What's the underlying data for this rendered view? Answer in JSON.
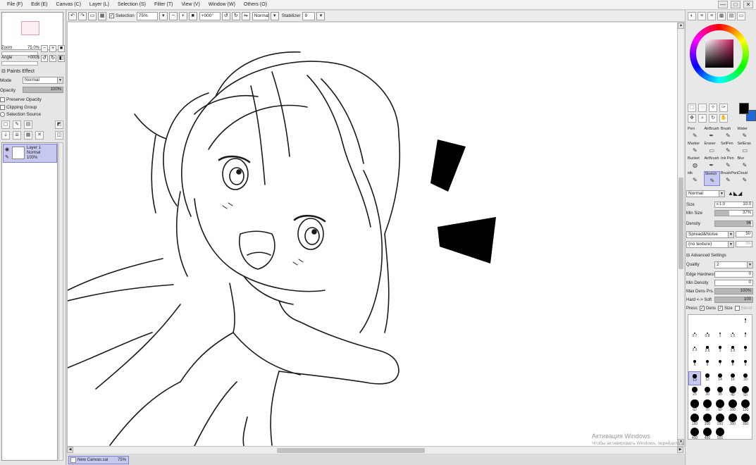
{
  "menu": [
    "File (F)",
    "Edit (E)",
    "Canvas (C)",
    "Layer (L)",
    "Selection (S)",
    "Filter (T)",
    "View (V)",
    "Window (W)",
    "Others (O)"
  ],
  "window_buttons": [
    "—",
    "□",
    "✕"
  ],
  "navigator": {
    "zoom_label": "Zoom",
    "zoom_value": "75.0%",
    "angle_label": "Angle",
    "angle_value": "+000$"
  },
  "paints_effect": {
    "title": "Paints Effect",
    "mode_label": "Mode",
    "mode_value": "Normal",
    "opacity_label": "Opacity",
    "opacity_value": "100%",
    "opacity_fraction": 1.0,
    "checkboxes": [
      "Preserve Opacity",
      "Clipping Group",
      "Selection Source"
    ]
  },
  "layer": {
    "name": "Layer 1",
    "mode": "Normal",
    "opacity": "100%"
  },
  "toolbar": {
    "selection_label": "Selection",
    "zoom_value": "75%",
    "rotation_value": "+000°",
    "mode_value": "Normal",
    "stabilizer_label": "Stabilizer",
    "stabilizer_value": "9"
  },
  "document": {
    "tab_name": "New Canvas.sai",
    "tab_zoom": "75%"
  },
  "watermark": {
    "line1": "Активация Windows",
    "line2": "Чтобы активировать Windows, перейдите в раздел \"Параметры\"."
  },
  "tools": [
    {
      "label": "Pen",
      "icon": "✎"
    },
    {
      "label": "AirBrush",
      "icon": "✒"
    },
    {
      "label": "Brush",
      "icon": "✎"
    },
    {
      "label": "Water",
      "icon": "✎"
    },
    {
      "label": "Marker",
      "icon": "✎"
    },
    {
      "label": "Eraser",
      "icon": "▭"
    },
    {
      "label": "SelPen",
      "icon": "✎"
    },
    {
      "label": "SelEras",
      "icon": "▭"
    },
    {
      "label": "Bucket",
      "icon": "◍"
    },
    {
      "label": "AirBrush",
      "icon": "✒"
    },
    {
      "label": "Ink Pen",
      "icon": "✎"
    },
    {
      "label": "Blur",
      "icon": "✎"
    },
    {
      "label": "idk",
      "icon": "✎"
    },
    {
      "label": "Sketch",
      "icon": "✎"
    },
    {
      "label": "BrushPen",
      "icon": "✎"
    },
    {
      "label": "Cloud",
      "icon": "✎"
    }
  ],
  "selected_tool": "Sketch",
  "brush_props": {
    "blend_mode": "Normal",
    "size_label": "Size",
    "size_multiplier": "x 1.0",
    "size_value": "10.0",
    "min_size_label": "Min Size",
    "min_size_value": "37%",
    "min_size_fraction": 0.37,
    "density_label": "Density",
    "density_value": "96",
    "density_fraction": 0.96,
    "shape_value": "Spread&Noise",
    "shape_strength": "50",
    "texture_value": "(no texture)",
    "texture_strength": "95",
    "advanced_title": "Advanced Settings",
    "quality_label": "Quality",
    "quality_value": "2",
    "edge_hardness_label": "Edge Hardness",
    "edge_hardness_value": "0",
    "min_density_label": "Min Density",
    "min_density_value": "0",
    "max_dens_label": "Max Dens Prs.",
    "max_dens_value": "100%",
    "max_dens_fraction": 1.0,
    "hard_soft_label": "Hard <-> Soft",
    "hard_soft_value": "100",
    "hard_soft_fraction": 1.0,
    "press_label": "Press:",
    "press_options": [
      "Dens",
      "Size",
      "Blend"
    ]
  },
  "brush_sizes": [
    "",
    "",
    "",
    "",
    "2",
    "0.7",
    "0.8",
    "1",
    "1.5",
    "2",
    "2.3",
    "2.6",
    "3",
    "3.5",
    "4",
    "5",
    "6",
    "7",
    "8",
    "9",
    "10",
    "12",
    "14",
    "16",
    "20",
    "25",
    "30",
    "35",
    "40",
    "50",
    "60",
    "70",
    "80",
    "100",
    "120",
    "160",
    "200",
    "250",
    "300",
    "350",
    "400",
    "450",
    "500"
  ],
  "selected_brush_size": "10",
  "colors": {
    "accent": "#c6c8ef",
    "accent_border": "#7d82d8",
    "foreground": "#000000",
    "background": "#1e6ad8"
  }
}
